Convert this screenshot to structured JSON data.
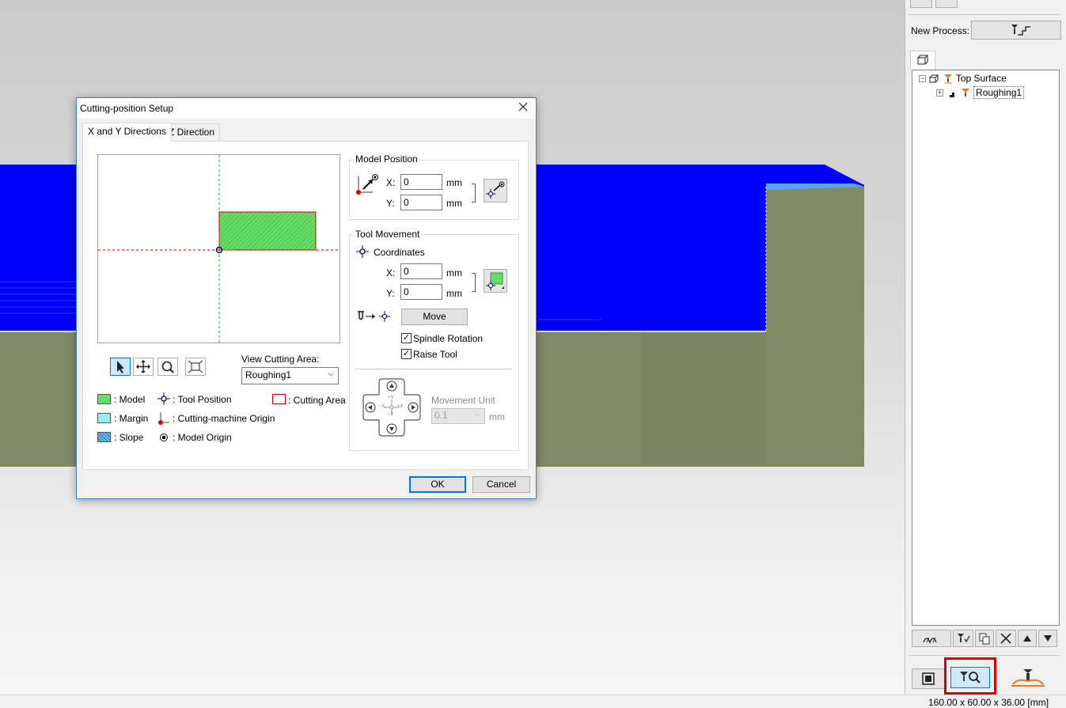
{
  "dialog": {
    "title": "Cutting-position Setup",
    "tabs": [
      {
        "label": "X and Y Directions"
      },
      {
        "label": "Z Direction"
      }
    ],
    "view_cutting_area": {
      "label": "View Cutting Area:",
      "value": "Roughing1"
    },
    "legend": {
      "model": ": Model",
      "margin": ": Margin",
      "slope": ": Slope",
      "tool_position": ": Tool Position",
      "cutting_machine_origin": ": Cutting-machine Origin",
      "model_origin": ": Model Origin",
      "cutting_area": ": Cutting Area"
    },
    "model_position": {
      "title": "Model Position",
      "x_label": "X:",
      "x_value": "0",
      "x_unit": "mm",
      "y_label": "Y:",
      "y_value": "0",
      "y_unit": "mm"
    },
    "tool_movement": {
      "title": "Tool Movement",
      "coordinates_label": "Coordinates",
      "x_label": "X:",
      "x_value": "0",
      "x_unit": "mm",
      "y_label": "Y:",
      "y_value": "0",
      "y_unit": "mm",
      "move_button": "Move",
      "spindle_rotation": {
        "label": "Spindle Rotation",
        "checked": true
      },
      "raise_tool": {
        "label": "Raise Tool",
        "checked": true
      },
      "movement_unit": {
        "label": "Movement Unit",
        "value": "0.1",
        "unit": "mm"
      },
      "jog_labels": {
        "plus_y": "+Y",
        "minus_y": "−Y",
        "minus_x": "−X",
        "plus_x": "+X"
      }
    },
    "ok_button": "OK",
    "cancel_button": "Cancel"
  },
  "right_panel": {
    "new_process_label": "New Process:",
    "tree": [
      {
        "label": "Top Surface",
        "level": 0
      },
      {
        "label": "Roughing1",
        "level": 1
      }
    ]
  },
  "status_bar": {
    "dimensions": "160.00 x 60.00 x 36.00 [mm]"
  },
  "colors": {
    "model_blue": "#0000ff",
    "model_side": "#808a65",
    "model_fill_green": "#66dd66",
    "cutting_area_red": "#cc0000",
    "selection_red": "#e00000",
    "accent": "#0078d7"
  },
  "icons": {
    "tool_buttons": [
      "select-arrow-icon",
      "pan-icon",
      "zoom-icon",
      "fit-icon"
    ],
    "bottom_buttons": [
      "panel-toggle-icon",
      "cutting-position-setup-icon",
      "start-cutting-icon"
    ]
  }
}
